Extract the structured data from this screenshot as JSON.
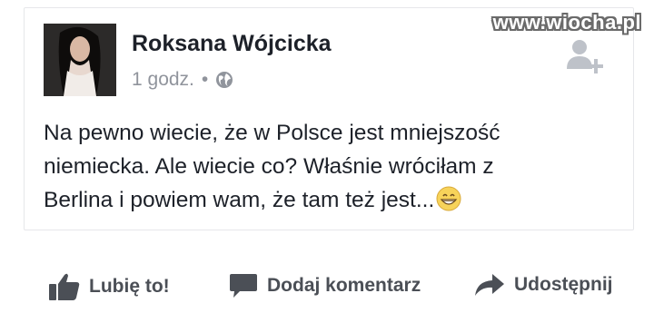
{
  "post": {
    "author": "Roksana Wójcicka",
    "time": "1 godz.",
    "separator": "•",
    "text_lines": [
      "Na pewno wiecie, że w Polsce jest mniejszość",
      "niemiecka. Ale wiecie co? Właśnie wróciłam z",
      "Berlina i powiem wam, że tam też jest..."
    ],
    "emoji": "grinning-face-emoji",
    "privacy_icon": "globe-icon",
    "add_friend_icon": "add-friend-icon"
  },
  "watermark": "www.wiocha.pl",
  "actions": {
    "like_label": "Lubię to!",
    "comment_label": "Dodaj komentarz",
    "share_label": "Udostępnij"
  },
  "colors": {
    "text": "#1d2129",
    "meta": "#90949c",
    "action": "#4b4f56"
  }
}
